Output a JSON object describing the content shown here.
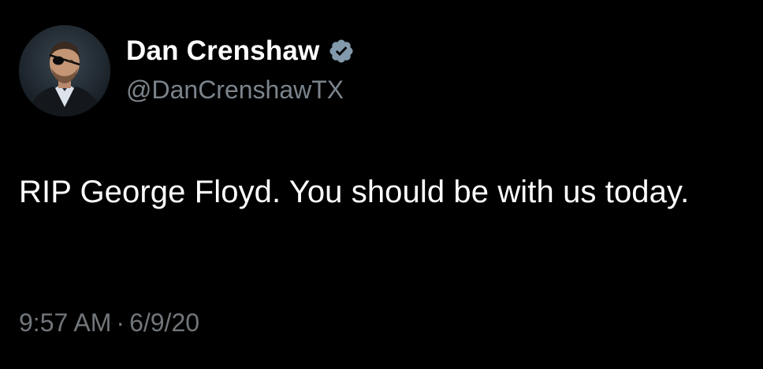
{
  "author": {
    "display_name": "Dan Crenshaw",
    "handle": "@DanCrenshawTX",
    "verified": true,
    "avatar_icon": "profile-photo",
    "verified_icon": "verified-badge-icon",
    "verified_color": "#829aab"
  },
  "tweet": {
    "text": "RIP George Floyd. You should be with us today.",
    "time": "9:57 AM",
    "separator": "·",
    "date": "6/9/20"
  },
  "colors": {
    "background": "#000000",
    "primary_text": "#ffffff",
    "secondary_text": "#71767b"
  }
}
